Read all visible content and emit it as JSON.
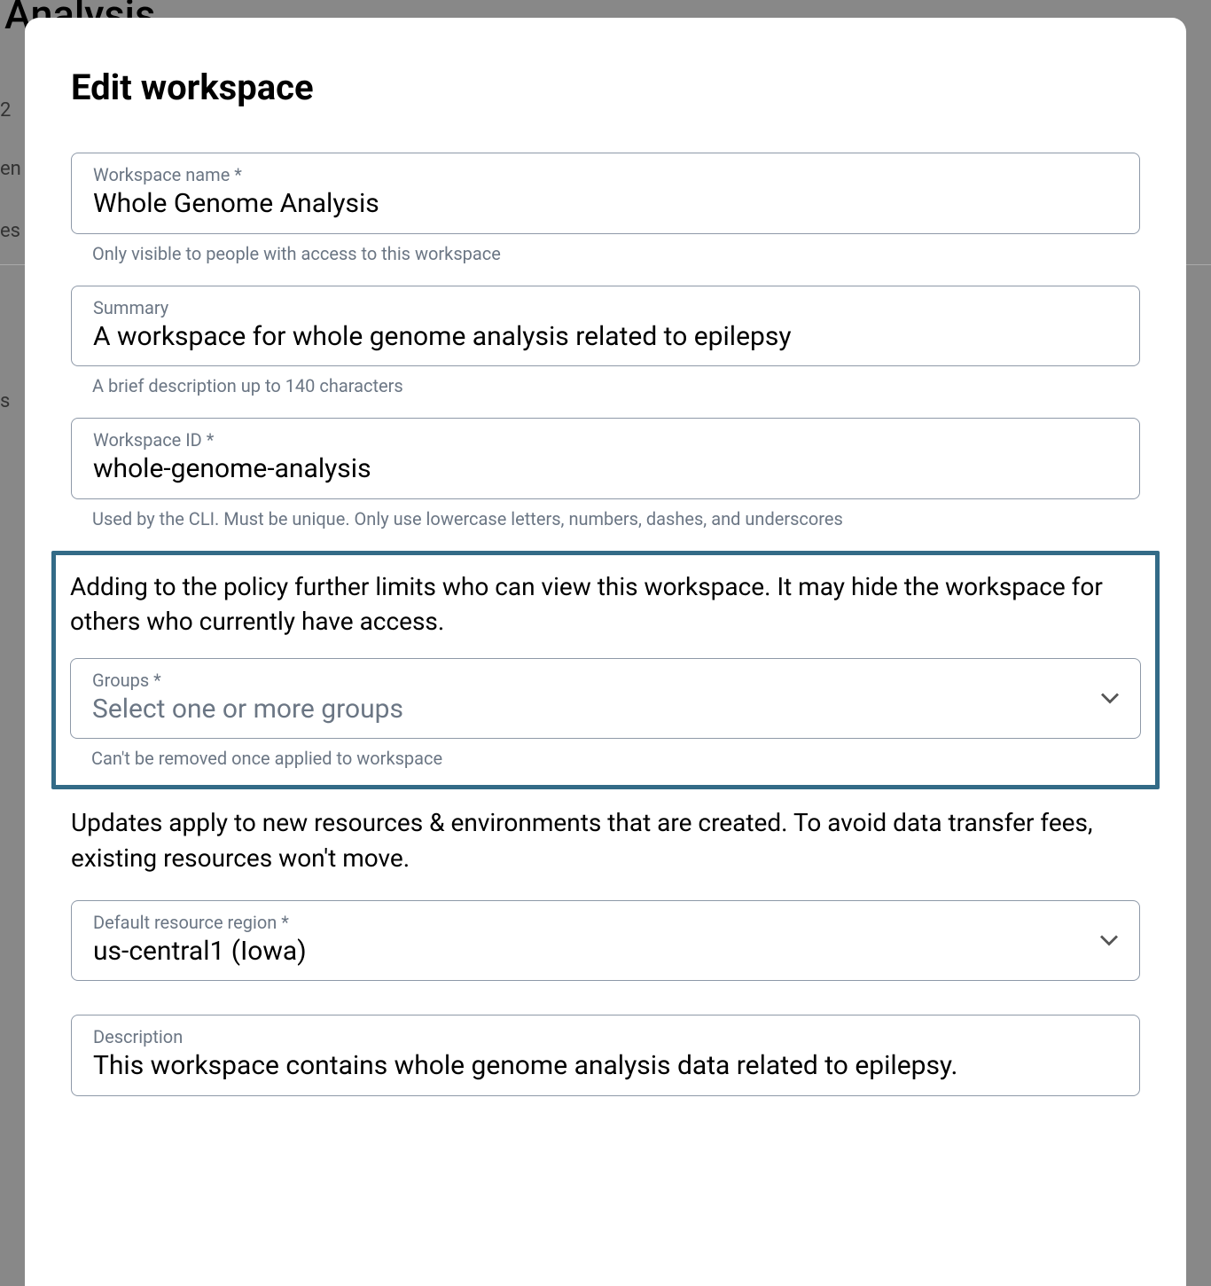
{
  "background": {
    "title_fragment": "nome Analysis",
    "t1": "2",
    "t2": "en",
    "t3": "es",
    "t4": "s"
  },
  "modal": {
    "title": "Edit workspace",
    "fields": {
      "workspace_name": {
        "label": "Workspace name *",
        "value": "Whole Genome Analysis",
        "helper": "Only visible to people with access to this workspace"
      },
      "summary": {
        "label": "Summary",
        "value": "A workspace for whole genome analysis related to epilepsy",
        "helper": "A brief description up to 140 characters"
      },
      "workspace_id": {
        "label": "Workspace ID *",
        "value": "whole-genome-analysis",
        "helper": "Used by the CLI. Must be unique. Only use lowercase letters, numbers, dashes, and underscores"
      },
      "groups": {
        "info": "Adding to the policy further limits who can view this workspace. It may hide the workspace for others who currently have access.",
        "label": "Groups *",
        "placeholder": "Select one or more groups",
        "helper": "Can't be removed once applied to workspace"
      },
      "region": {
        "info": "Updates apply to new resources & environments that are created. To avoid data transfer fees, existing resources won't move.",
        "label": "Default resource region *",
        "value": "us-central1 (Iowa)"
      },
      "description": {
        "label": "Description",
        "value": "This workspace contains whole genome analysis data related to epilepsy."
      }
    }
  }
}
